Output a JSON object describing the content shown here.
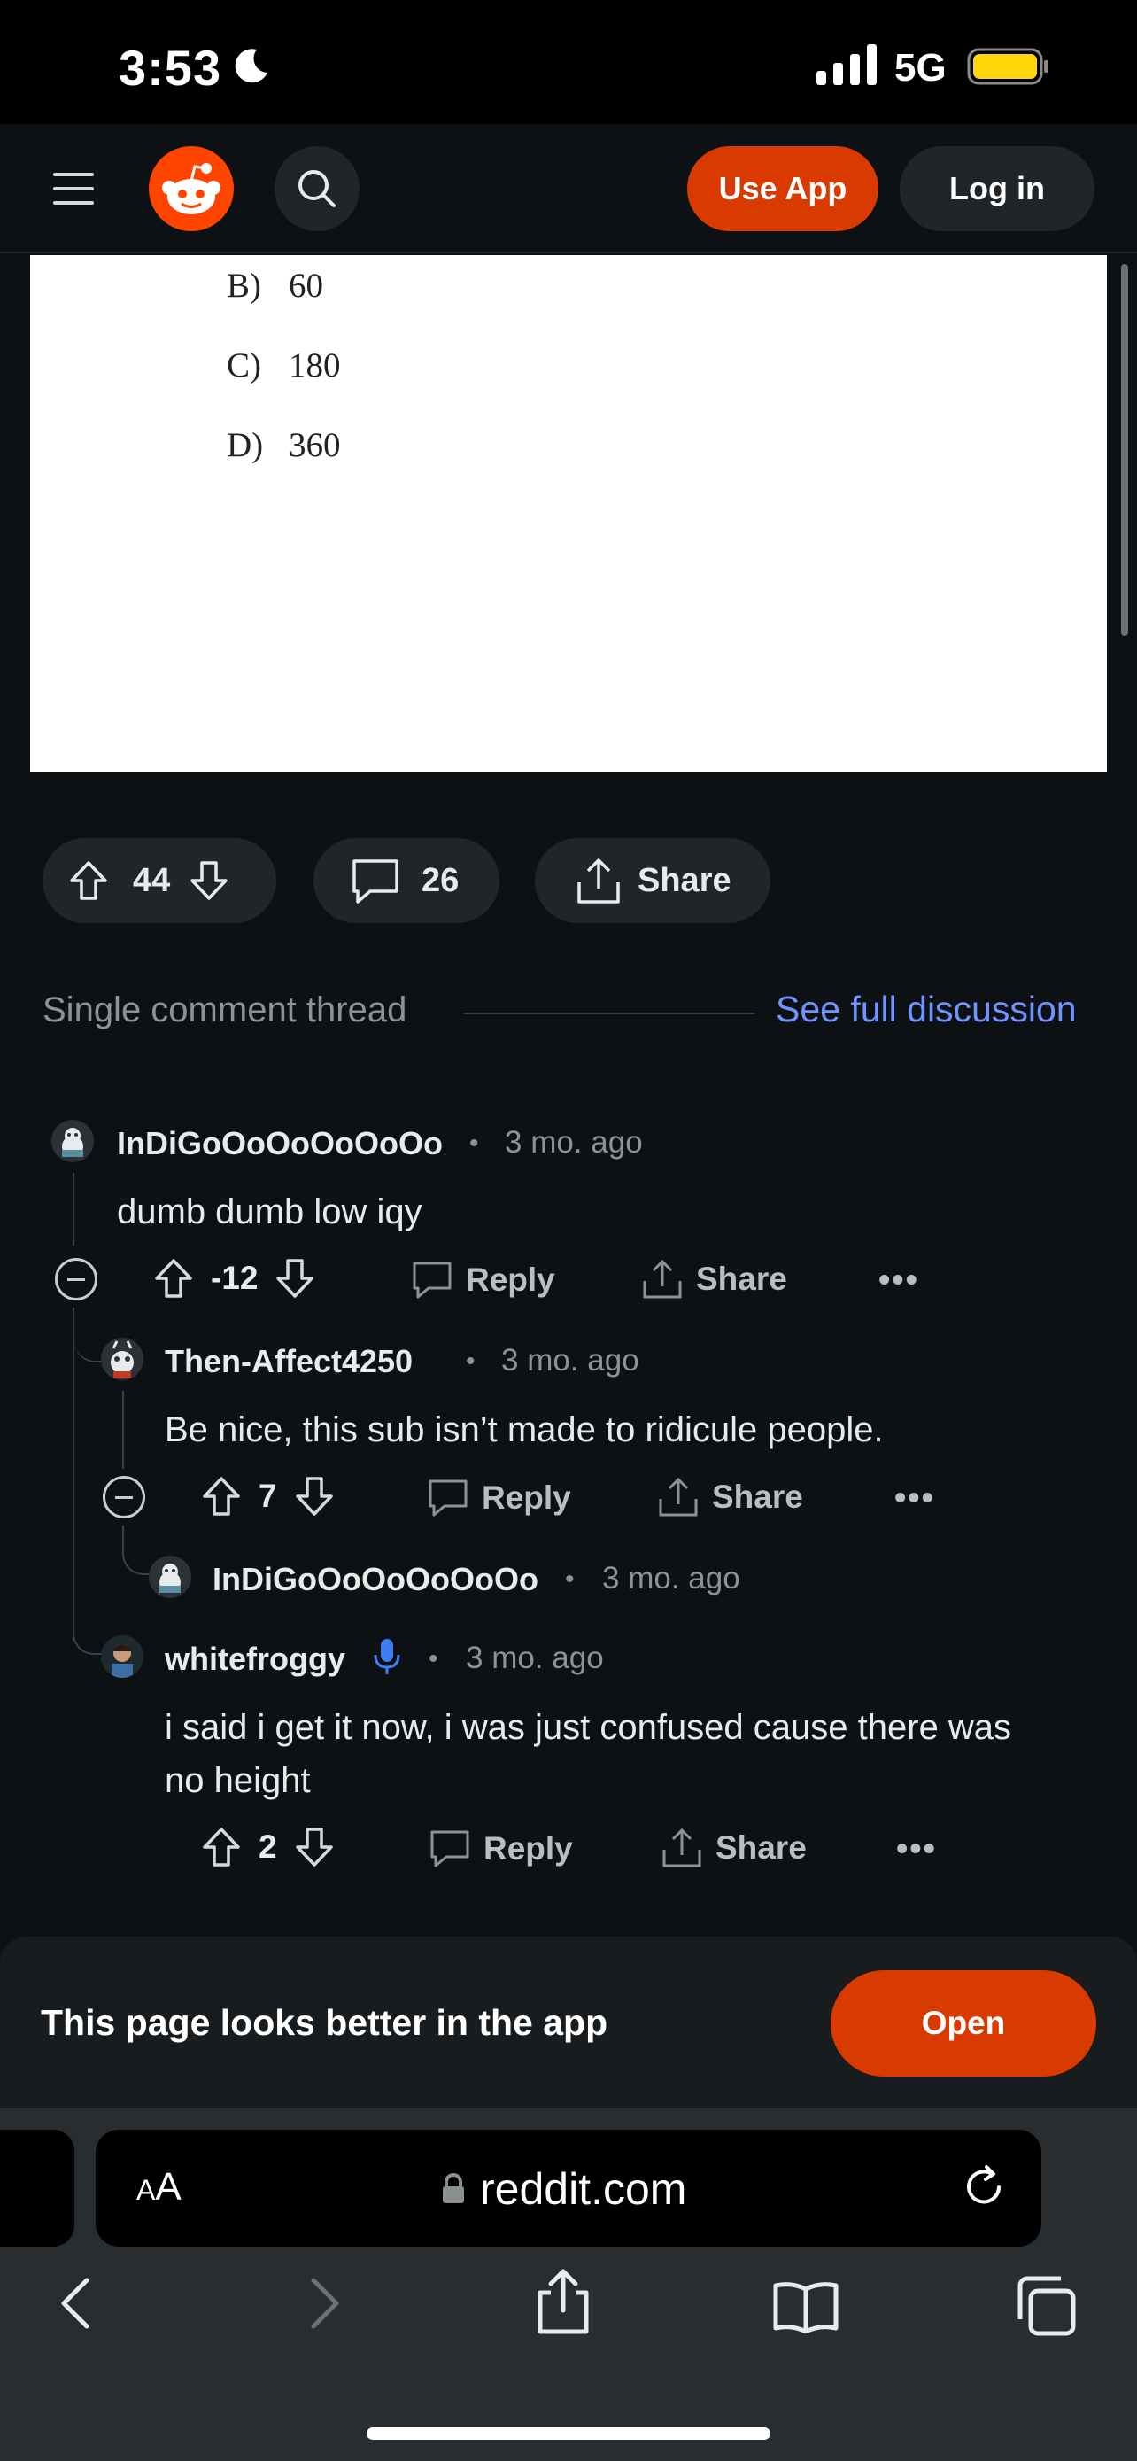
{
  "status_bar": {
    "time": "3:53",
    "network": "5G"
  },
  "header": {
    "use_app": "Use App",
    "log_in": "Log in"
  },
  "post_image": {
    "answers": [
      {
        "letter": "B)",
        "value": "60"
      },
      {
        "letter": "C)",
        "value": "180"
      },
      {
        "letter": "D)",
        "value": "360"
      }
    ]
  },
  "post_actions": {
    "votes": "44",
    "comments": "26",
    "share": "Share"
  },
  "thread": {
    "label": "Single comment thread",
    "full_link": "See full discussion"
  },
  "comments": [
    {
      "author": "InDiGoOoOoOoOoOo",
      "dot": "•",
      "time": "3 mo. ago",
      "body": "dumb dumb low iqy",
      "votes": "-12",
      "reply": "Reply",
      "share": "Share",
      "more": "•••"
    },
    {
      "author": "Then-Affect4250",
      "dot": "•",
      "time": "3 mo. ago",
      "body": "Be nice, this sub isn’t made to ridicule people.",
      "votes": "7",
      "reply": "Reply",
      "share": "Share",
      "more": "•••"
    },
    {
      "author": "InDiGoOoOoOoOoOo",
      "dot": "•",
      "time": "3 mo. ago"
    },
    {
      "author": "whitefroggy",
      "dot": "•",
      "time": "3 mo. ago",
      "body_line1": "i said i get it now, i was just confused cause there was",
      "body_line2": "no height",
      "votes": "2",
      "reply": "Reply",
      "share": "Share",
      "more": "•••"
    }
  ],
  "banner": {
    "text": "This page looks better in the app",
    "open": "Open"
  },
  "safari": {
    "aa_small": "A",
    "aa_big": "A",
    "url": "reddit.com"
  },
  "colors": {
    "accent": "#d93a00",
    "link": "#7193ff",
    "background": "#0e1113"
  }
}
